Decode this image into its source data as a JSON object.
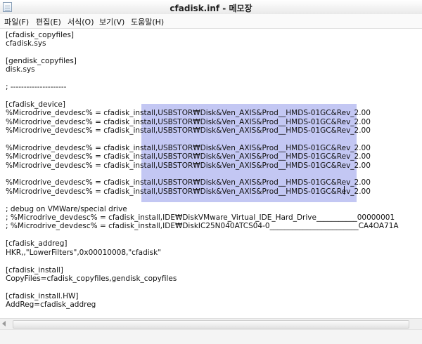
{
  "window": {
    "title": "cfadisk.inf - 메모장"
  },
  "menu": [
    "파일(F)",
    "편집(E)",
    "서식(O)",
    "보기(V)",
    "도움말(H)"
  ],
  "lines": [
    "[cfadisk_copyfiles]",
    "cfadisk.sys",
    "",
    "[gendisk_copyfiles]",
    "disk.sys",
    "",
    "; ---------------------",
    "",
    "[cfadisk_device]",
    "%Microdrive_devdesc% = cfadisk_install,USBSTOR₩Disk&Ven_AXIS&Prod__HMDS-01GC&Rev_2.00",
    "%Microdrive_devdesc% = cfadisk_install,USBSTOR₩Disk&Ven_AXIS&Prod__HMDS-01GC&Rev_2.00",
    "%Microdrive_devdesc% = cfadisk_install,USBSTOR₩Disk&Ven_AXIS&Prod__HMDS-01GC&Rev_2.00",
    "",
    "%Microdrive_devdesc% = cfadisk_install,USBSTOR₩Disk&Ven_AXIS&Prod__HMDS-01GC&Rev_2.00",
    "%Microdrive_devdesc% = cfadisk_install,USBSTOR₩Disk&Ven_AXIS&Prod__HMDS-01GC&Rev_2.00",
    "%Microdrive_devdesc% = cfadisk_install,USBSTOR₩Disk&Ven_AXIS&Prod__HMDS-01GC&Rev_2.00",
    "",
    "%Microdrive_devdesc% = cfadisk_install,USBSTOR₩Disk&Ven_AXIS&Prod__HMDS-01GC&Rev_2.00",
    "%Microdrive_devdesc% = cfadisk_install,USBSTOR₩Disk&Ven_AXIS&Prod__HMDS-01GC&Rev_2.00",
    "",
    "; debug on VMWare/special drive",
    "; %Microdrive_devdesc% = cfadisk_install,IDE₩DiskVMware_Virtual_IDE_Hard_Drive___________00000001",
    "; %Microdrive_devdesc% = cfadisk_install,IDE₩DiskIC25N040ATCS04-0________________________CA4OA71A",
    "",
    "[cfadisk_addreg]",
    "HKR,,\"LowerFilters\",0x00010008,\"cfadisk\"",
    "",
    "[cfadisk_install]",
    "CopyFiles=cfadisk_copyfiles,gendisk_copyfiles",
    "",
    "[cfadisk_install.HW]",
    "AddReg=cfadisk_addreg"
  ]
}
